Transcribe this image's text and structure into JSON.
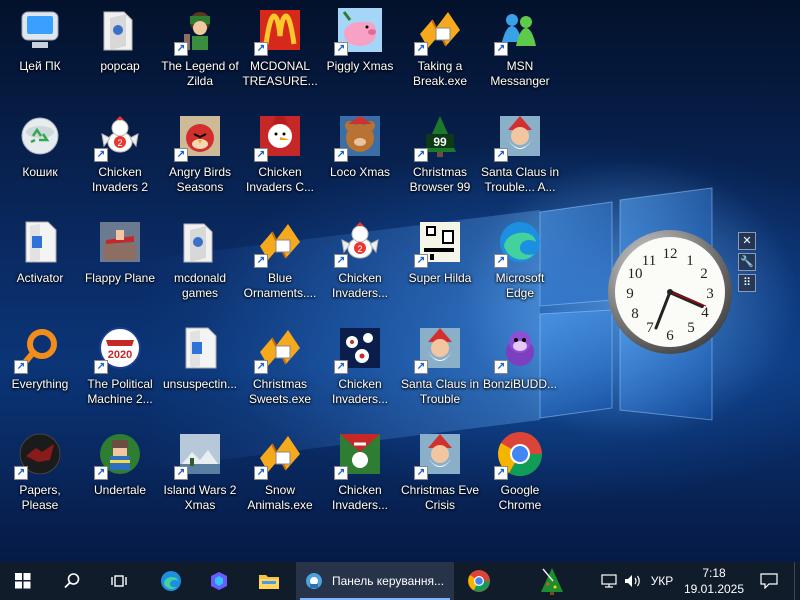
{
  "desktop": {
    "icons": [
      {
        "label": "Цей ПК",
        "shortcut": false,
        "icon": "this-pc-icon"
      },
      {
        "label": "popcap",
        "shortcut": false,
        "icon": "folder-icon"
      },
      {
        "label": "The Legend of Zilda",
        "shortcut": true,
        "icon": "game-icon"
      },
      {
        "label": "MCDONAL TREASURE...",
        "shortcut": true,
        "icon": "mcdonalds-icon"
      },
      {
        "label": "Piggly Xmas",
        "shortcut": true,
        "icon": "pig-icon"
      },
      {
        "label": "Taking a Break.exe",
        "shortcut": true,
        "icon": "popcap-icon"
      },
      {
        "label": "MSN Messanger",
        "shortcut": true,
        "icon": "msn-icon"
      },
      {
        "label": "Кошик",
        "shortcut": false,
        "icon": "recycle-bin-icon"
      },
      {
        "label": "Chicken Invaders 2",
        "shortcut": true,
        "icon": "chicken-icon"
      },
      {
        "label": "Angry Birds Seasons",
        "shortcut": true,
        "icon": "angry-birds-icon"
      },
      {
        "label": "Chicken Invaders C...",
        "shortcut": true,
        "icon": "snowman-icon"
      },
      {
        "label": "Loco Xmas",
        "shortcut": true,
        "icon": "bear-icon"
      },
      {
        "label": "Christmas Browser 99",
        "shortcut": true,
        "icon": "xmas-tree-icon"
      },
      {
        "label": "Santa Claus in Trouble... A...",
        "shortcut": true,
        "icon": "santa-icon"
      },
      {
        "label": "Activator",
        "shortcut": false,
        "icon": "file-icon"
      },
      {
        "label": "Flappy Plane",
        "shortcut": false,
        "icon": "plane-icon"
      },
      {
        "label": "mcdonald games",
        "shortcut": false,
        "icon": "folder-icon"
      },
      {
        "label": "Blue Ornaments....",
        "shortcut": true,
        "icon": "popcap-icon"
      },
      {
        "label": "Chicken Invaders...",
        "shortcut": true,
        "icon": "chicken-icon"
      },
      {
        "label": "Super Hilda",
        "shortcut": true,
        "icon": "pixel-game-icon"
      },
      {
        "label": "Microsoft Edge",
        "shortcut": true,
        "icon": "edge-icon"
      },
      {
        "label": "Everything",
        "shortcut": true,
        "icon": "everything-icon"
      },
      {
        "label": "The Political Machine 2...",
        "shortcut": true,
        "icon": "political-icon"
      },
      {
        "label": "unsuspectin...",
        "shortcut": false,
        "icon": "file-icon"
      },
      {
        "label": "Christmas Sweets.exe",
        "shortcut": true,
        "icon": "popcap-icon"
      },
      {
        "label": "Chicken Invaders...",
        "shortcut": true,
        "icon": "chicken-space-icon"
      },
      {
        "label": "Santa Claus in Trouble",
        "shortcut": true,
        "icon": "santa-icon"
      },
      {
        "label": "BonziBUDD...",
        "shortcut": true,
        "icon": "bonzi-icon"
      },
      {
        "label": "Papers, Please",
        "shortcut": true,
        "icon": "papers-please-icon"
      },
      {
        "label": "Undertale",
        "shortcut": true,
        "icon": "undertale-icon"
      },
      {
        "label": "Island Wars 2 Xmas",
        "shortcut": true,
        "icon": "island-icon"
      },
      {
        "label": "Snow Animals.exe",
        "shortcut": true,
        "icon": "popcap-icon"
      },
      {
        "label": "Chicken Invaders...",
        "shortcut": true,
        "icon": "chicken-xmas-icon"
      },
      {
        "label": "Christmas Eve Crisis",
        "shortcut": true,
        "icon": "santa-icon"
      },
      {
        "label": "Google Chrome",
        "shortcut": true,
        "icon": "chrome-icon"
      }
    ]
  },
  "gadget": {
    "name": "clock",
    "time": "7:18",
    "tools": [
      "close-icon",
      "wrench-icon",
      "drag-icon"
    ]
  },
  "taskbar": {
    "window_title": "Панель керування...",
    "language": "УКР",
    "time": "7:18",
    "date": "19.01.2025",
    "accent": "#7fb4ff"
  }
}
